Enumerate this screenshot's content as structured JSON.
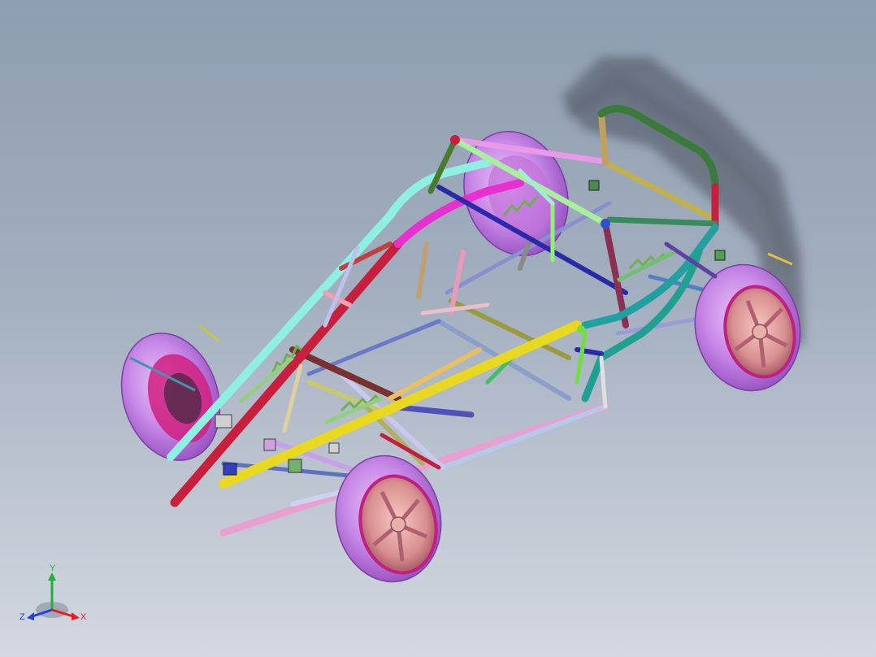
{
  "viewport": {
    "background_top": "#8e9db0",
    "background_bottom": "#d3d8e0"
  },
  "triad": {
    "x_label": "X",
    "y_label": "Y",
    "z_label": "Z",
    "x_color": "#e02020",
    "y_color": "#20b040",
    "z_color": "#2040e0"
  },
  "model": {
    "wheel_tire_color": "#cc88ee",
    "wheel_rim_color": "#e8a0a0",
    "hub_color": "#d0208a"
  }
}
